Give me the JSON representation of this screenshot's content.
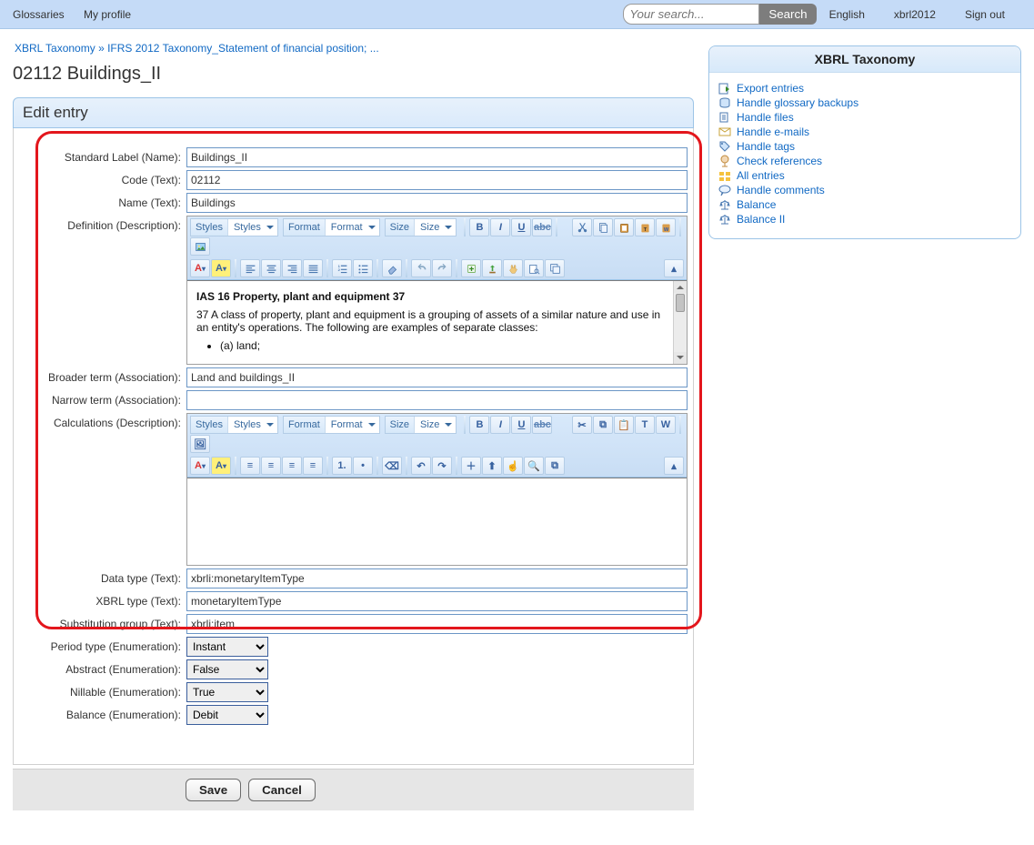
{
  "topbar": {
    "glossaries": "Glossaries",
    "my_profile": "My profile",
    "search_placeholder": "Your search...",
    "search_btn": "Search",
    "language": "English",
    "user": "xbrl2012",
    "signout": "Sign out"
  },
  "breadcrumb": {
    "root": "XBRL Taxonomy",
    "sep": "»",
    "leaf": "IFRS 2012 Taxonomy_Statement of financial position; ..."
  },
  "page_title": "02112 Buildings_II",
  "panel_title": "Edit entry",
  "labels": {
    "std": "Standard Label (Name):",
    "code": "Code (Text):",
    "name": "Name (Text):",
    "def": "Definition (Description):",
    "broader": "Broader term (Association):",
    "narrow": "Narrow term (Association):",
    "calc": "Calculations (Description):",
    "dtype": "Data type (Text):",
    "xtype": "XBRL type (Text):",
    "sgroup": "Substitution group (Text):",
    "ptype": "Period type (Enumeration):",
    "abstract": "Abstract (Enumeration):",
    "nillable": "Nillable (Enumeration):",
    "balance": "Balance (Enumeration):"
  },
  "values": {
    "std": "Buildings_II",
    "code": "02112",
    "name": "Buildings",
    "broader": "Land and buildings_II",
    "narrow": "",
    "dtype": "xbrli:monetaryItemType",
    "xtype": "monetaryItemType",
    "sgroup": "xbrli:item",
    "ptype": "Instant",
    "abstract": "False",
    "nillable": "True",
    "balance": "Debit"
  },
  "rte": {
    "styles_lbl": "Styles",
    "styles_val": "Styles",
    "format_lbl": "Format",
    "format_val": "Format",
    "size_lbl": "Size",
    "size_val": "Size"
  },
  "definition": {
    "title": "IAS 16 Property, plant and equipment 37",
    "para": "37 A class of property, plant and equipment is a grouping of assets of a similar nature and use in an entity's operations. The following are examples of separate classes:",
    "bullet_a": "(a) land;"
  },
  "buttons": {
    "save": "Save",
    "cancel": "Cancel"
  },
  "side": {
    "title": "XBRL Taxonomy",
    "items": [
      "Export entries",
      "Handle glossary backups",
      "Handle files",
      "Handle e-mails",
      "Handle tags",
      "Check references",
      "All entries",
      "Handle comments",
      "Balance",
      "Balance II"
    ]
  }
}
